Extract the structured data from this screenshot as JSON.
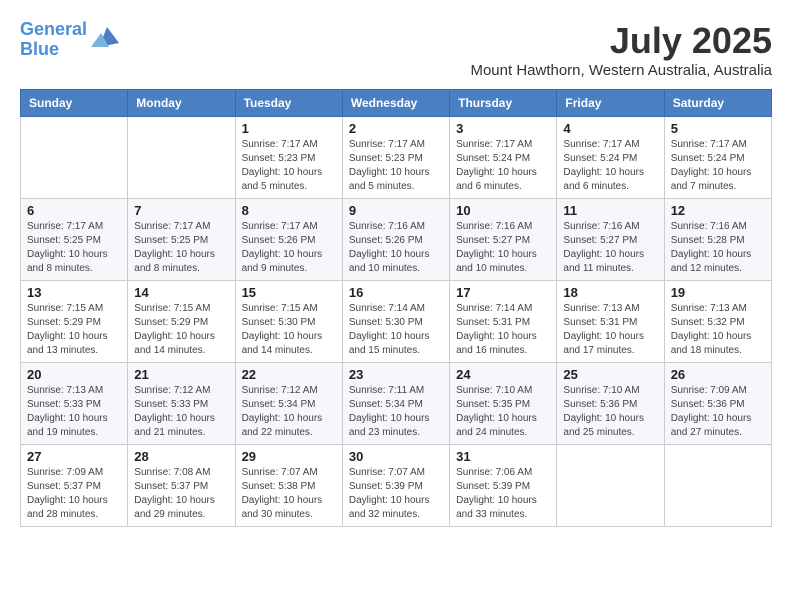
{
  "logo": {
    "line1": "General",
    "line2": "Blue"
  },
  "title": "July 2025",
  "location": "Mount Hawthorn, Western Australia, Australia",
  "days_header": [
    "Sunday",
    "Monday",
    "Tuesday",
    "Wednesday",
    "Thursday",
    "Friday",
    "Saturday"
  ],
  "weeks": [
    [
      {
        "day": "",
        "info": ""
      },
      {
        "day": "",
        "info": ""
      },
      {
        "day": "1",
        "info": "Sunrise: 7:17 AM\nSunset: 5:23 PM\nDaylight: 10 hours\nand 5 minutes."
      },
      {
        "day": "2",
        "info": "Sunrise: 7:17 AM\nSunset: 5:23 PM\nDaylight: 10 hours\nand 5 minutes."
      },
      {
        "day": "3",
        "info": "Sunrise: 7:17 AM\nSunset: 5:24 PM\nDaylight: 10 hours\nand 6 minutes."
      },
      {
        "day": "4",
        "info": "Sunrise: 7:17 AM\nSunset: 5:24 PM\nDaylight: 10 hours\nand 6 minutes."
      },
      {
        "day": "5",
        "info": "Sunrise: 7:17 AM\nSunset: 5:24 PM\nDaylight: 10 hours\nand 7 minutes."
      }
    ],
    [
      {
        "day": "6",
        "info": "Sunrise: 7:17 AM\nSunset: 5:25 PM\nDaylight: 10 hours\nand 8 minutes."
      },
      {
        "day": "7",
        "info": "Sunrise: 7:17 AM\nSunset: 5:25 PM\nDaylight: 10 hours\nand 8 minutes."
      },
      {
        "day": "8",
        "info": "Sunrise: 7:17 AM\nSunset: 5:26 PM\nDaylight: 10 hours\nand 9 minutes."
      },
      {
        "day": "9",
        "info": "Sunrise: 7:16 AM\nSunset: 5:26 PM\nDaylight: 10 hours\nand 10 minutes."
      },
      {
        "day": "10",
        "info": "Sunrise: 7:16 AM\nSunset: 5:27 PM\nDaylight: 10 hours\nand 10 minutes."
      },
      {
        "day": "11",
        "info": "Sunrise: 7:16 AM\nSunset: 5:27 PM\nDaylight: 10 hours\nand 11 minutes."
      },
      {
        "day": "12",
        "info": "Sunrise: 7:16 AM\nSunset: 5:28 PM\nDaylight: 10 hours\nand 12 minutes."
      }
    ],
    [
      {
        "day": "13",
        "info": "Sunrise: 7:15 AM\nSunset: 5:29 PM\nDaylight: 10 hours\nand 13 minutes."
      },
      {
        "day": "14",
        "info": "Sunrise: 7:15 AM\nSunset: 5:29 PM\nDaylight: 10 hours\nand 14 minutes."
      },
      {
        "day": "15",
        "info": "Sunrise: 7:15 AM\nSunset: 5:30 PM\nDaylight: 10 hours\nand 14 minutes."
      },
      {
        "day": "16",
        "info": "Sunrise: 7:14 AM\nSunset: 5:30 PM\nDaylight: 10 hours\nand 15 minutes."
      },
      {
        "day": "17",
        "info": "Sunrise: 7:14 AM\nSunset: 5:31 PM\nDaylight: 10 hours\nand 16 minutes."
      },
      {
        "day": "18",
        "info": "Sunrise: 7:13 AM\nSunset: 5:31 PM\nDaylight: 10 hours\nand 17 minutes."
      },
      {
        "day": "19",
        "info": "Sunrise: 7:13 AM\nSunset: 5:32 PM\nDaylight: 10 hours\nand 18 minutes."
      }
    ],
    [
      {
        "day": "20",
        "info": "Sunrise: 7:13 AM\nSunset: 5:33 PM\nDaylight: 10 hours\nand 19 minutes."
      },
      {
        "day": "21",
        "info": "Sunrise: 7:12 AM\nSunset: 5:33 PM\nDaylight: 10 hours\nand 21 minutes."
      },
      {
        "day": "22",
        "info": "Sunrise: 7:12 AM\nSunset: 5:34 PM\nDaylight: 10 hours\nand 22 minutes."
      },
      {
        "day": "23",
        "info": "Sunrise: 7:11 AM\nSunset: 5:34 PM\nDaylight: 10 hours\nand 23 minutes."
      },
      {
        "day": "24",
        "info": "Sunrise: 7:10 AM\nSunset: 5:35 PM\nDaylight: 10 hours\nand 24 minutes."
      },
      {
        "day": "25",
        "info": "Sunrise: 7:10 AM\nSunset: 5:36 PM\nDaylight: 10 hours\nand 25 minutes."
      },
      {
        "day": "26",
        "info": "Sunrise: 7:09 AM\nSunset: 5:36 PM\nDaylight: 10 hours\nand 27 minutes."
      }
    ],
    [
      {
        "day": "27",
        "info": "Sunrise: 7:09 AM\nSunset: 5:37 PM\nDaylight: 10 hours\nand 28 minutes."
      },
      {
        "day": "28",
        "info": "Sunrise: 7:08 AM\nSunset: 5:37 PM\nDaylight: 10 hours\nand 29 minutes."
      },
      {
        "day": "29",
        "info": "Sunrise: 7:07 AM\nSunset: 5:38 PM\nDaylight: 10 hours\nand 30 minutes."
      },
      {
        "day": "30",
        "info": "Sunrise: 7:07 AM\nSunset: 5:39 PM\nDaylight: 10 hours\nand 32 minutes."
      },
      {
        "day": "31",
        "info": "Sunrise: 7:06 AM\nSunset: 5:39 PM\nDaylight: 10 hours\nand 33 minutes."
      },
      {
        "day": "",
        "info": ""
      },
      {
        "day": "",
        "info": ""
      }
    ]
  ]
}
